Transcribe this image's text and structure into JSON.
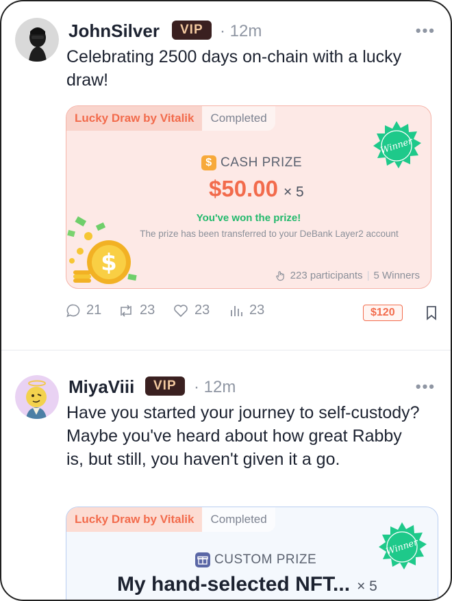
{
  "posts": [
    {
      "author": "JohnSilver",
      "badge": "VIP",
      "time": "· 12m",
      "more": "•••",
      "text": "Celebrating 2500 days on-chain with a lucky draw!",
      "card": {
        "tag": "Lucky Draw by Vitalik",
        "status": "Completed",
        "prize_type": "CASH PRIZE",
        "amount": "$50.00",
        "multiplier": "× 5",
        "won_text": "You've won the prize!",
        "transfer_text": "The prize has been transferred to your DeBank Layer2 account",
        "participants": "223 participants",
        "separator": "|",
        "winners": "5 Winners",
        "winner_badge": "Winner"
      },
      "actions": {
        "comments": "21",
        "reposts": "23",
        "likes": "23",
        "views": "23",
        "price": "$120"
      }
    },
    {
      "author": "MiyaViii",
      "badge": "VIP",
      "time": "· 12m",
      "more": "•••",
      "text": "Have you started your journey to self-custody? Maybe you've heard about how great Rabby is, but still, you haven't given it a go.",
      "card": {
        "tag": "Lucky Draw by Vitalik",
        "status": "Completed",
        "prize_type": "CUSTOM PRIZE",
        "title": "My hand-selected NFT...",
        "multiplier": "× 5",
        "winner_badge": "Winner"
      }
    }
  ],
  "colors": {
    "accent": "#f26b4c",
    "success": "#22b96c",
    "winner_green": "#1ec98a",
    "vip_bg": "#3a2020"
  }
}
